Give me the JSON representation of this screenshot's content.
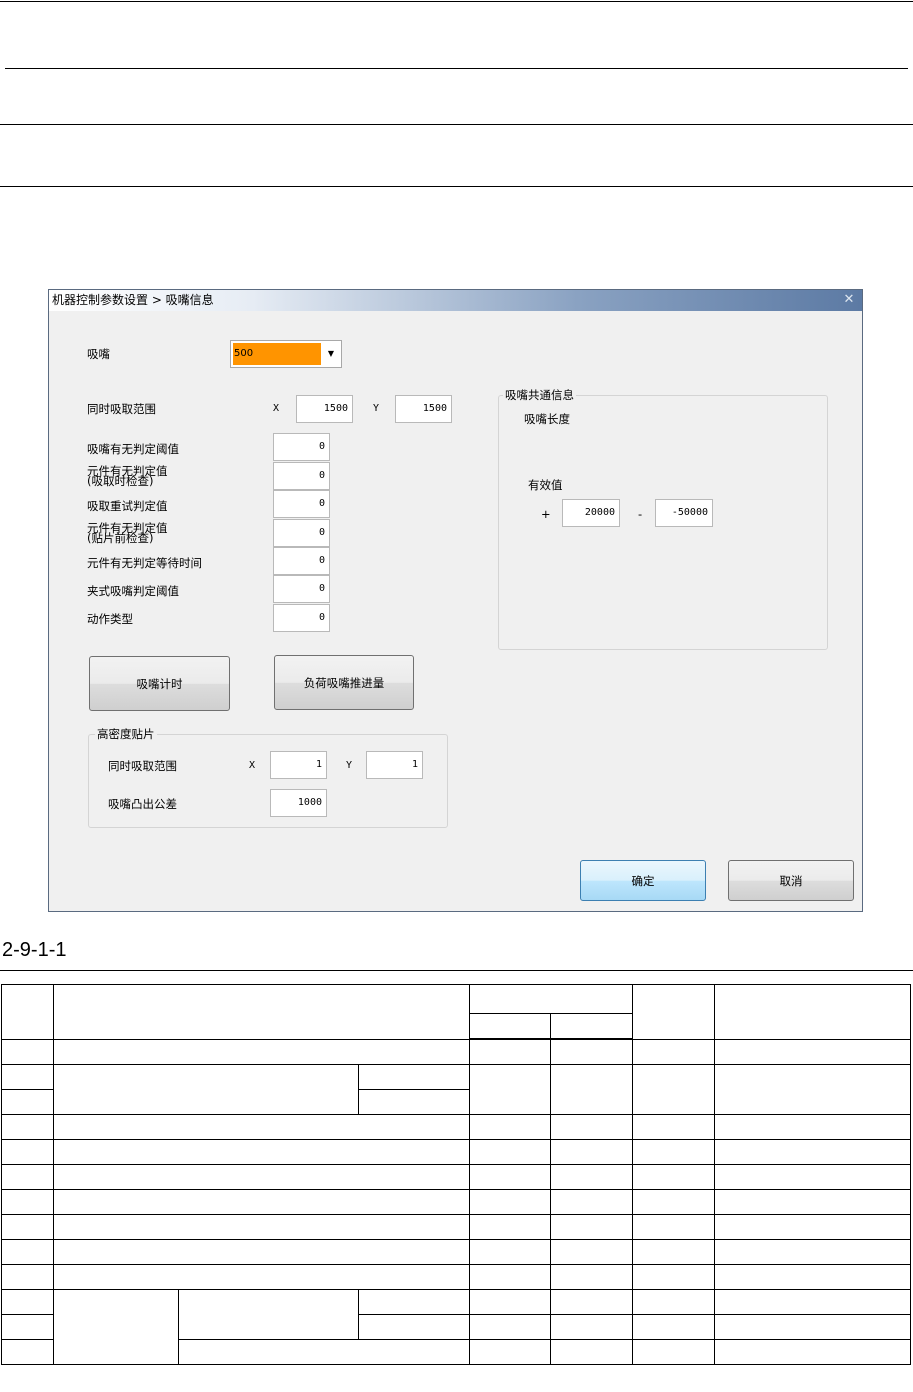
{
  "window": {
    "title": "机器控制参数设置 > 吸嘴信息",
    "nozzle": {
      "label": "吸嘴",
      "value": "500"
    },
    "simul_range": {
      "label": "同时吸取范围",
      "x_label": "X",
      "x_value": "1500",
      "y_label": "Y",
      "y_value": "1500"
    },
    "params": [
      {
        "label_line1": "吸嘴有无判定阈值",
        "label_line2": "",
        "value": "0"
      },
      {
        "label_line1": "元件有无判定值",
        "label_line2": "(吸取时检查)",
        "value": "0"
      },
      {
        "label_line1": "吸取重试判定值",
        "label_line2": "",
        "value": "0"
      },
      {
        "label_line1": "元件有无判定值",
        "label_line2": "(贴片前检查)",
        "value": "0"
      },
      {
        "label_line1": "元件有无判定等待时间",
        "label_line2": "",
        "value": "0"
      },
      {
        "label_line1": "夹式吸嘴判定阈值",
        "label_line2": "",
        "value": "0"
      },
      {
        "label_line1": "动作类型",
        "label_line2": "",
        "value": "0"
      }
    ],
    "buttons": {
      "nozzle_timing": "吸嘴计时",
      "load_push": "负荷吸嘴推进量",
      "ok": "确定",
      "cancel": "取消"
    },
    "common": {
      "caption": "吸嘴共通信息",
      "length_label": "吸嘴长度",
      "valid_label": "有效值",
      "plus": "+",
      "plus_value": "20000",
      "minus": "-",
      "minus_value": "-50000"
    },
    "hd": {
      "caption": "高密度贴片",
      "range_label": "同时吸取范围",
      "x_label": "X",
      "x_value": "1",
      "y_label": "Y",
      "y_value": "1",
      "tol_label": "吸嘴凸出公差",
      "tol_value": "1000"
    }
  },
  "figure_caption": "2-9-1-1"
}
